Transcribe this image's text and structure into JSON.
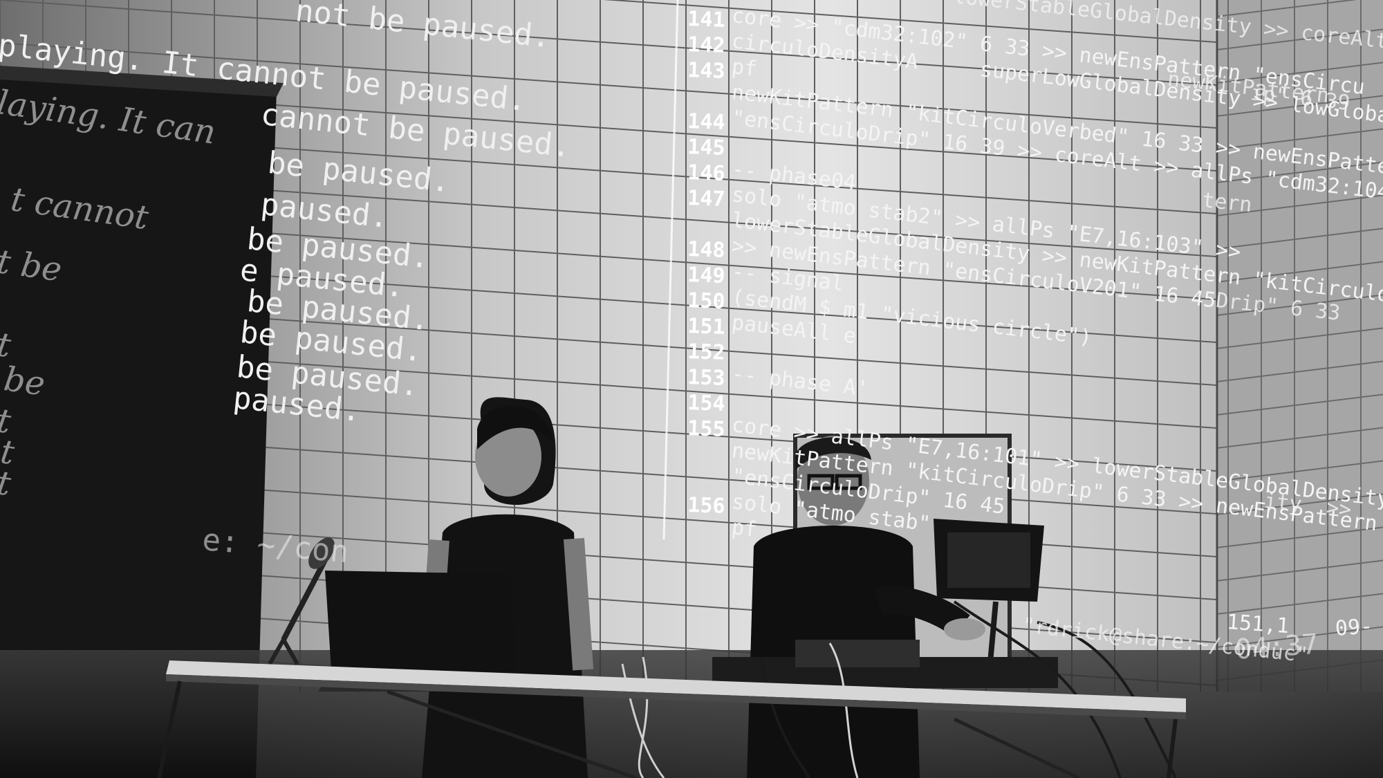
{
  "projection_text": {
    "left_lines": [
      "not be paused.",
      "playing. It cannot be paused.",
      "cannot be paused.",
      "be paused.",
      "paused.",
      "be paused.",
      "e paused.",
      "be paused.",
      "be paused.",
      "be paused.",
      "paused."
    ],
    "left_prompt": "e: ~/con",
    "dark_panel_fragments": [
      "laying. It can",
      "t cannot",
      "t be",
      "t",
      "be",
      "t",
      "t",
      "t"
    ],
    "code_lines": [
      {
        "num": "141",
        "text": "core >> \"cdm32:102\" 6 33 >> newEnsPattern \"ensCircu"
      },
      {
        "num": "142",
        "text": "circuloDensityA     superLowGlobalDensity >> lowGlobalDensity"
      },
      {
        "num": "143",
        "text": "pf"
      },
      {
        "num": "",
        "text": "newKitPattern \"kitCirculoVerbed\" 16 33 >> newEnsPattern"
      },
      {
        "num": "144",
        "text": "\"ensCirculoDrip\" 16 39 >> coreAlt >> allPs \"cdm32:104\""
      },
      {
        "num": "145",
        "text": ""
      },
      {
        "num": "146",
        "text": "-- phase04"
      },
      {
        "num": "147",
        "text": "solo \"atmo stab2\" >> allPs \"E7,16:103\" >>"
      },
      {
        "num": "",
        "text": "lowerStableGlobalDensity >> newKitPattern \"kitCirculoDrip\" 6 33"
      },
      {
        "num": "148",
        "text": ">> newEnsPattern \"ensCirculoV201\" 16 45"
      },
      {
        "num": "149",
        "text": "-- signal"
      },
      {
        "num": "150",
        "text": "(sendM $ m1 \"vicious circle\")"
      },
      {
        "num": "151",
        "text": "pauseAll e"
      },
      {
        "num": "152",
        "text": ""
      },
      {
        "num": "153",
        "text": "-- phase A'"
      },
      {
        "num": "154",
        "text": ""
      },
      {
        "num": "155",
        "text": "core >> allPs \"E7,16:101\" >> lowerStableGlobalDensity >>"
      },
      {
        "num": "",
        "text": "newKitPattern \"kitCirculoDrip\" 6 33 >> newEnsPattern"
      },
      {
        "num": "",
        "text": "\"ensCirculoDrip\" 16 45"
      },
      {
        "num": "156",
        "text": "solo \"atmo stab\""
      },
      {
        "num": "",
        "text": "pf"
      }
    ],
    "top_right_fragments": [
      "lowerStableGlobalDensity >> coreAlt",
      "newKitPattern",
      "ip\" 6 39",
      "Drip\" 6 33",
      "tern",
      "ity  >>"
    ],
    "status_bar": {
      "position": "151,1",
      "prompt": "\"rdrick@share:~/conduc\"",
      "time": "04:37",
      "date": "09-"
    }
  },
  "colors": {
    "wall_light": "#d8d8d8",
    "wall_dark": "#1a1a1a",
    "grout": "#6a6a6a",
    "projection_text": "#f4f4f4"
  }
}
